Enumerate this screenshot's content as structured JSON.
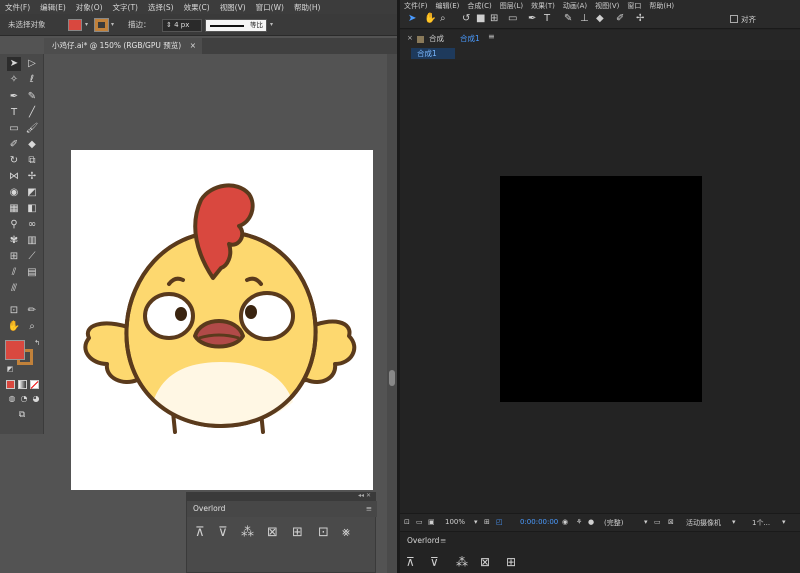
{
  "illustrator": {
    "menu": [
      "文件(F)",
      "编辑(E)",
      "对象(O)",
      "文字(T)",
      "选择(S)",
      "效果(C)",
      "视图(V)",
      "窗口(W)",
      "帮助(H)"
    ],
    "control_bar": {
      "selection_status": "未选择对象",
      "stroke_label": "描边：",
      "stroke_value": "4 px",
      "profile_label": "等比",
      "fill_color": "#d9483f",
      "stroke_color": "#c1813a"
    },
    "document_tab": {
      "title": "小鸡仔.ai* @ 150% (RGB/GPU 预览)",
      "close": "×"
    },
    "toolbox": {
      "fill_color": "#d9483f",
      "stroke_color": "#c1813a"
    },
    "overlord_panel": {
      "title": "Overlord",
      "menu": "≡",
      "collapse": "◂◂ ✕"
    },
    "artwork": {
      "body_color": "#fdd86f",
      "belly_color": "#fff7e4",
      "comb_color": "#d9483f",
      "beak_color": "#b14a48",
      "outline_color": "#5a3a1c"
    }
  },
  "after_effects": {
    "menu": [
      "文件(F)",
      "编辑(E)",
      "合成(C)",
      "图层(L)",
      "效果(T)",
      "动画(A)",
      "视图(V)",
      "窗口",
      "帮助(H)"
    ],
    "toolbar": {
      "snap_label": "对齐"
    },
    "composition_panel": {
      "close": "×",
      "label": "合成",
      "comp_name": "合成1",
      "menu": "≡",
      "subtab": "合成1",
      "comp_color": "#000000"
    },
    "viewer_bar": {
      "zoom": "100%",
      "timecode": "0:00:00:00",
      "resolution": "(完整)",
      "camera": "活动摄像机",
      "views": "1个..."
    },
    "overlord_panel": {
      "title": "Overlord",
      "menu": "≡"
    }
  }
}
